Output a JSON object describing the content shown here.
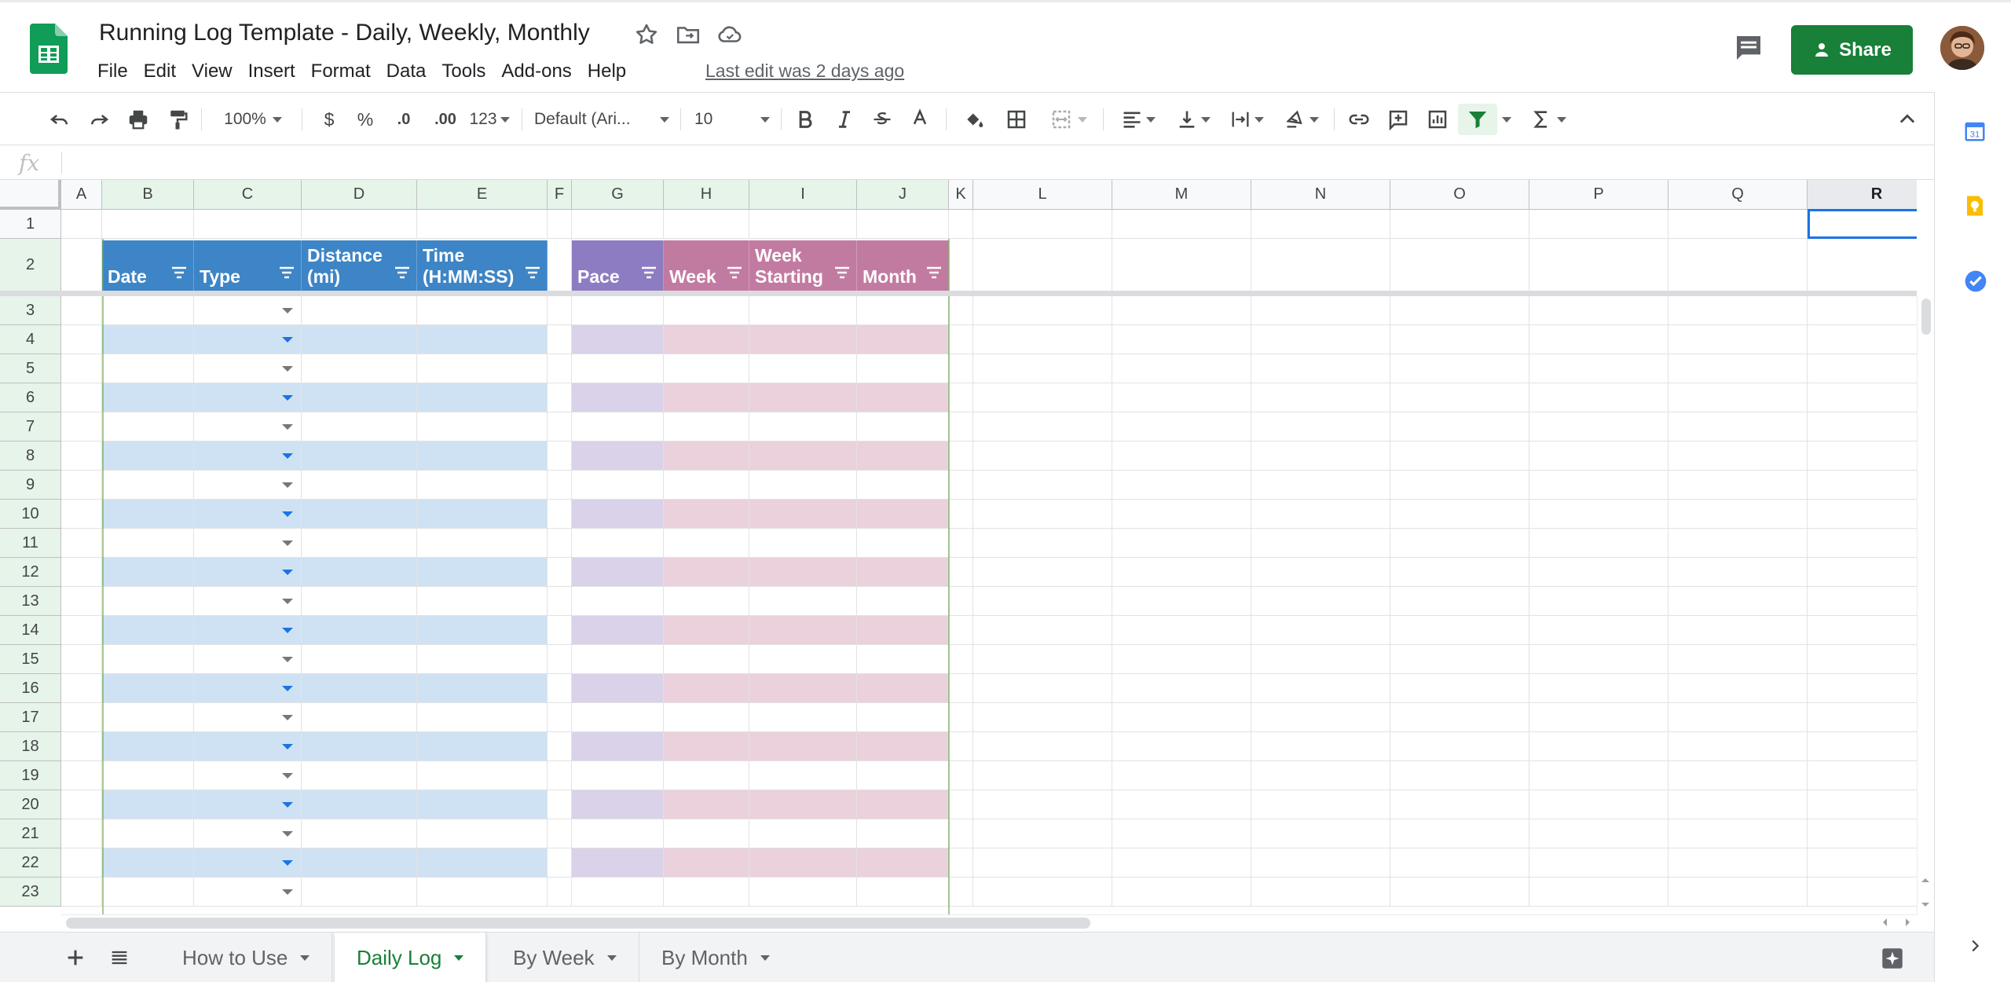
{
  "header": {
    "title": "Running Log Template - Daily, Weekly, Monthly",
    "menu": [
      "File",
      "Edit",
      "View",
      "Insert",
      "Format",
      "Data",
      "Tools",
      "Add-ons",
      "Help"
    ],
    "last_edit": "Last edit was 2 days ago",
    "share_label": "Share"
  },
  "toolbar": {
    "zoom": "100%",
    "currency": "$",
    "percent": "%",
    "decrease_decimal": ".0",
    "increase_decimal": ".00",
    "more_formats": "123",
    "font": "Default (Ari...",
    "font_size": "10"
  },
  "formula_bar": {
    "fx": "fx"
  },
  "columns": [
    "A",
    "B",
    "C",
    "D",
    "E",
    "F",
    "G",
    "H",
    "I",
    "J",
    "K",
    "L",
    "M",
    "N",
    "O",
    "P",
    "Q",
    "R"
  ],
  "rows": [
    "1",
    "2",
    "3",
    "4",
    "5",
    "6",
    "7",
    "8",
    "9",
    "10",
    "11",
    "12",
    "13",
    "14",
    "15",
    "16",
    "17",
    "18",
    "19",
    "20",
    "21",
    "22",
    "23"
  ],
  "table_headers": {
    "date": "Date",
    "type": "Type",
    "distance": "Distance (mi)",
    "time": "Time (H:MM:SS)",
    "pace": "Pace",
    "week": "Week",
    "week_starting": "Week Starting",
    "month": "Month"
  },
  "sheet_tabs": [
    "How to Use",
    "Daily Log",
    "By Week",
    "By Month"
  ],
  "active_tab": "Daily Log",
  "colors": {
    "header_blue": "#3d85c6",
    "header_purple": "#8e7cc3",
    "header_pink": "#c27ba0",
    "band_blue": "#cfe2f3",
    "band_purple": "#d9d2e9",
    "band_pink": "#ead1dc",
    "share_green": "#188038"
  },
  "icons": {
    "logo": "google-sheets-logo",
    "side_panel": [
      "calendar-icon",
      "keep-icon",
      "tasks-icon"
    ]
  }
}
